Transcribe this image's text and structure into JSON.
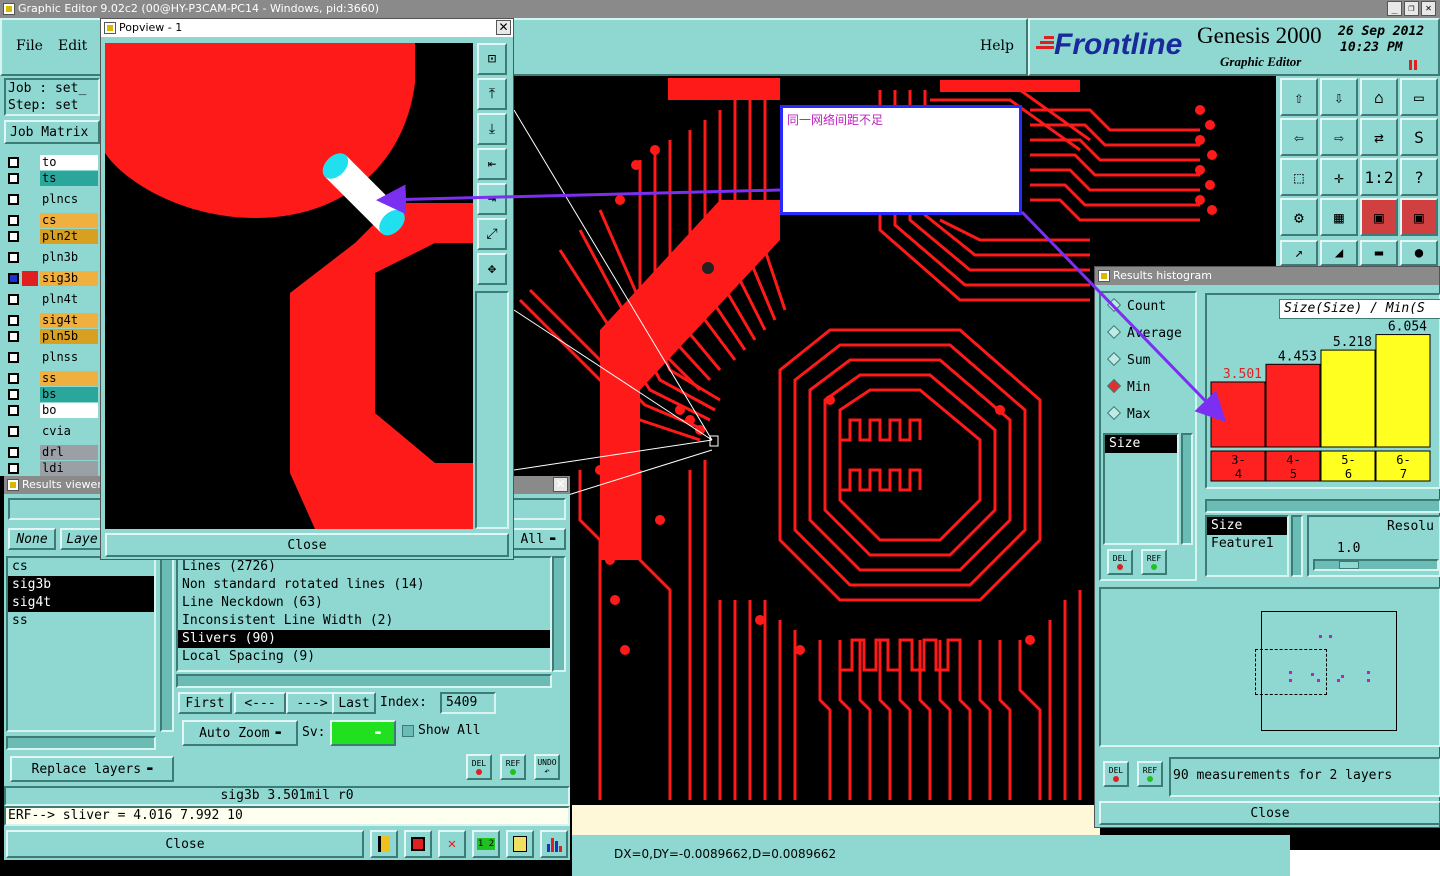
{
  "window_title": "Graphic Editor 9.02c2 (00@HY-P3CAM-PC14 - Windows, pid:3660)",
  "menu": {
    "file": "File",
    "edit": "Edit",
    "help": "Help"
  },
  "brand": {
    "logo": "Frontline",
    "product": "Genesis 2000",
    "subtitle": "Graphic Editor",
    "date": "26 Sep 2012",
    "time": "10:23 PM"
  },
  "job": {
    "job_label": "Job : set_",
    "step_label": "Step: set",
    "matrix_button": "Job Matrix"
  },
  "layers": [
    {
      "name": "to",
      "color": "#ffffff"
    },
    {
      "name": "ts",
      "color": "#2aa69a"
    },
    {
      "name": "plncs",
      "color": "#8fd8d2"
    },
    {
      "name": "cs",
      "color": "#f0b040"
    },
    {
      "name": "pln2t",
      "color": "#d8a020"
    },
    {
      "name": "pln3b",
      "color": "#8fd8d2"
    },
    {
      "name": "sig3b",
      "color": "#f0b040"
    },
    {
      "name": "pln4t",
      "color": "#8fd8d2"
    },
    {
      "name": "sig4t",
      "color": "#f0b040"
    },
    {
      "name": "pln5b",
      "color": "#d8a020"
    },
    {
      "name": "plnss",
      "color": "#8fd8d2"
    },
    {
      "name": "ss",
      "color": "#f0b040"
    },
    {
      "name": "bs",
      "color": "#2aa69a"
    },
    {
      "name": "bo",
      "color": "#ffffff"
    },
    {
      "name": "cvia",
      "color": "#8fd8d2"
    },
    {
      "name": "drl",
      "color": "#9aa0a6"
    },
    {
      "name": "ldi",
      "color": "#9aa0a6"
    }
  ],
  "popview": {
    "title": "Popview - 1",
    "close": "Close"
  },
  "annotation": {
    "note": "同一网络间距不足"
  },
  "results_viewer": {
    "title": "Results viewer",
    "none_btn": "None",
    "layers_btn": "Laye",
    "all_btn": "All",
    "layer_list": [
      "cs",
      "sig3b",
      "sig4t",
      "ss"
    ],
    "categories": [
      "Lines (2726)",
      "Non standard rotated lines (14)",
      "Line Neckdown (63)",
      "Inconsistent Line Width (2)",
      "Slivers (90)",
      "Local Spacing (9)"
    ],
    "selected_category": "Slivers (90)",
    "first": "First",
    "prev": "<---",
    "next": "--->",
    "last": "Last",
    "index_label": "Index:",
    "index_value": "5409",
    "auto_zoom": "Auto Zoom",
    "sv_label": "Sv:",
    "show_all": "Show All",
    "replace_layers": "Replace layers",
    "status": "sig3b 3.501mil  r0",
    "erf": "ERF--> sliver = 4.016 7.992 10",
    "close": "Close",
    "del": "DEL",
    "ref": "REF",
    "undo": "UNDO"
  },
  "histogram": {
    "title": "Results histogram",
    "modes": [
      "Count",
      "Average",
      "Sum",
      "Min",
      "Max"
    ],
    "selected_mode": "Min",
    "attr_list": [
      "Size"
    ],
    "attr_list2": [
      "Size",
      "Feature1"
    ],
    "chart_title": "Size(Size) / Min(S",
    "resolution_label": "Resolu",
    "resolution_value": "1.0",
    "summary": "90 measurements for 2 layers",
    "close": "Close",
    "del": "DEL",
    "ref": "REF"
  },
  "chart_data": {
    "type": "bar",
    "categories": [
      "3-4",
      "4-5",
      "5-6",
      "6-7"
    ],
    "values": [
      3.501,
      4.453,
      5.218,
      6.054
    ],
    "value_labels": [
      "3.501",
      "4.453",
      "5.218",
      "6.054"
    ],
    "colors": [
      "#ff2020",
      "#ff2020",
      "#ffff20",
      "#ffff20"
    ],
    "ylim": [
      0,
      7
    ]
  },
  "coords": "DX=0,DY=-0.0089662,D=0.0089662",
  "colors": {
    "panel": "#8fd8d2",
    "trace": "#ff1a1a",
    "accent_purple": "#7b2ff0"
  }
}
